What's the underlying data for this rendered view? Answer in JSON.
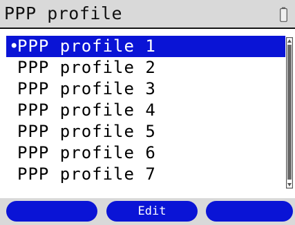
{
  "header": {
    "title": "PPP profile",
    "status_icon": "battery-icon"
  },
  "list": {
    "selected_index": 0,
    "selected_marker": "•",
    "items": [
      {
        "label": "PPP profile 1"
      },
      {
        "label": "PPP profile 2"
      },
      {
        "label": "PPP profile 3"
      },
      {
        "label": "PPP profile 4"
      },
      {
        "label": "PPP profile 5"
      },
      {
        "label": "PPP profile 6"
      },
      {
        "label": "PPP profile 7"
      }
    ]
  },
  "softkeys": {
    "left_label": "",
    "center_label": "Edit",
    "right_label": ""
  },
  "colors": {
    "selection_blue": "#0a14d6",
    "bar_gray": "#d9d9d9",
    "text_black": "#000000"
  }
}
